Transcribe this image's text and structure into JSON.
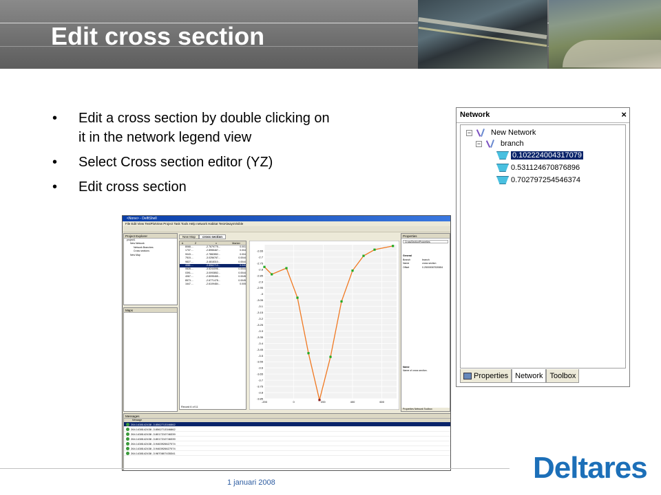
{
  "title": "Edit cross section",
  "bullets": [
    "Edit a cross section by double clicking on it in the network legend view",
    "Select Cross section editor (YZ)",
    "Edit cross section"
  ],
  "network_panel": {
    "title": "Network",
    "close": "×",
    "root": "New Network",
    "branch": "branch",
    "cross_sections": [
      "0.102224004317079",
      "0.531124670876896",
      "0.702797254546374"
    ],
    "selected_index": 0,
    "tabs": [
      "Properties",
      "Network",
      "Toolbox"
    ],
    "active_tab": "Network"
  },
  "app": {
    "window_title": "<None> - DelftShell",
    "menu": "File  Edit  View  TestPlotView  Project  Task  Tools  Help  network  Habitat  TestAlwaysVisible",
    "project_explorer": "Project Explorer",
    "tree": [
      "project1",
      "New Network",
      "Network Branches",
      "Cross sections",
      "New Map"
    ],
    "tabs": [
      "New Map",
      "cross section"
    ],
    "table_headers": [
      "Δ",
      "Z",
      "x",
      "Marker"
    ],
    "table_rows": [
      [
        "8068....",
        "-2.7679775...",
        "0.001"
      ],
      [
        "1737....",
        "-2.8955467...",
        "0.004"
      ],
      [
        "9043....",
        "-2.7882852...",
        "0.004"
      ],
      [
        "7515....",
        "-3.0256767...",
        "0.0044"
      ],
      [
        "9827....",
        "-3.4818310...",
        "0.0044"
      ],
      [
        "4081....",
        "-3.8562713...",
        "0.041"
      ],
      [
        "0828....",
        "-3.5244096...",
        "0.0044"
      ],
      [
        "0391....",
        "-3.0093852...",
        "0.0044"
      ],
      [
        "4067....",
        "-2.8095465...",
        "0.0045"
      ],
      [
        "8573....",
        "-2.6771478...",
        "0.0045"
      ],
      [
        "1647....",
        "-2.6109484...",
        "0.005"
      ]
    ],
    "maps": "Maps",
    "record": "Record 6 of 11",
    "properties": "Properties",
    "properties_type": "CrossSectionProperties",
    "prop_group": "General",
    "props": [
      [
        "Branch",
        "branch"
      ],
      [
        "Name",
        "cross section"
      ],
      [
        "Offset",
        "0.25000067520654"
      ]
    ],
    "desc_title": "Name",
    "desc_text": "Name of cross section.",
    "prop_tabs": "Properties  Network  Toolbox",
    "messages_title": "Messages",
    "message_header": "Message",
    "messages": [
      "264.1438142438 -3.8562713346862",
      "264.1438142438 -3.8562713346862",
      "264.1438142438 -3.8017210746339",
      "264.1438142438 -3.8017210746339",
      "264.1438142438 -3.9463926627074",
      "264.1438142438 -3.9463926627074",
      "264.1438142438 -3.9870807435341"
    ]
  },
  "chart_data": {
    "type": "line",
    "x": [
      -200,
      -150,
      -50,
      25,
      100,
      175,
      250,
      325,
      400,
      475,
      550,
      675
    ],
    "values": [
      -2.78,
      -2.84,
      -2.79,
      -3.03,
      -3.48,
      -3.86,
      -3.51,
      -3.06,
      -2.81,
      -2.69,
      -2.64,
      -2.61
    ],
    "xlim": [
      -200,
      700
    ],
    "ylim": [
      -3.85,
      -2.6
    ],
    "x_ticks": [
      "-200",
      "0",
      "200",
      "400",
      "600"
    ],
    "y_ticks": [
      "-2.65",
      "-2.7",
      "-2.75",
      "-2.8",
      "-2.85",
      "-2.9",
      "-2.95",
      "-3",
      "-3.05",
      "-3.1",
      "-3.15",
      "-3.2",
      "-3.25",
      "-3.3",
      "-3.35",
      "-3.4",
      "-3.45",
      "-3.5",
      "-3.55",
      "-3.6",
      "-3.65",
      "-3.7",
      "-3.75",
      "-3.8",
      "-3.85"
    ],
    "line_color": "#f07820",
    "point_color": "#22aa22",
    "selected_point_color": "#882222",
    "selected_index": 5
  },
  "footer": {
    "date": "1 januari 2008",
    "logo": "Deltares"
  }
}
